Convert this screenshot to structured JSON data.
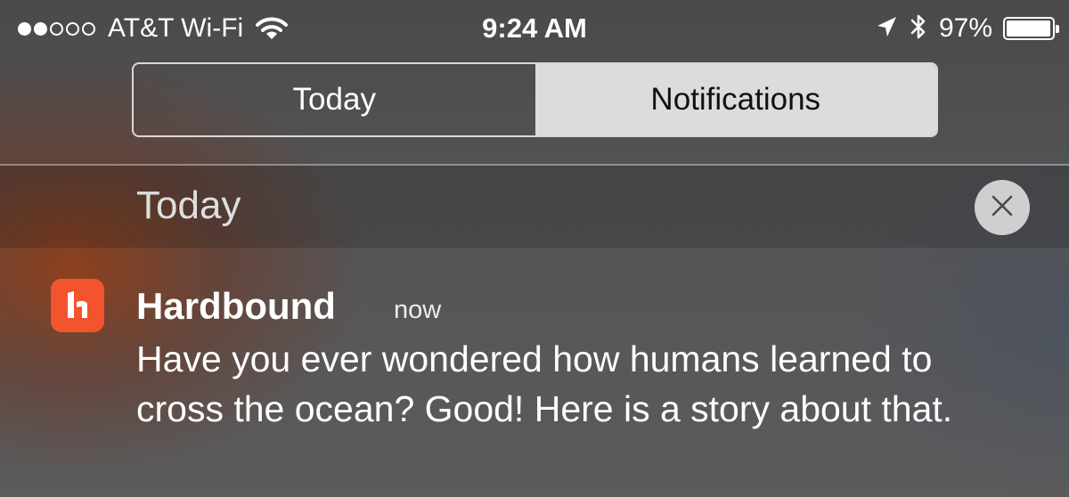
{
  "status_bar": {
    "signal_dots": {
      "filled": 2,
      "total": 5
    },
    "carrier": "AT&T Wi-Fi",
    "time": "9:24 AM",
    "battery_percent": "97%",
    "battery_level": 0.97,
    "icons": [
      "wifi-icon",
      "location-arrow-icon",
      "bluetooth-icon",
      "battery-icon"
    ]
  },
  "segmented_control": {
    "tabs": [
      {
        "label": "Today",
        "selected": false
      },
      {
        "label": "Notifications",
        "selected": true
      }
    ]
  },
  "section": {
    "title": "Today",
    "clear_icon": "close-icon"
  },
  "notification": {
    "app_icon": "hardbound-app-icon",
    "app_name": "Hardbound",
    "time": "now",
    "body": "Have you ever wondered how humans learned to cross the ocean? Good! Here is a story about that."
  },
  "colors": {
    "app_icon": "#f2542d",
    "segment_active_bg": "#dcdcdc",
    "clear_button_bg": "#cfcfcf"
  }
}
